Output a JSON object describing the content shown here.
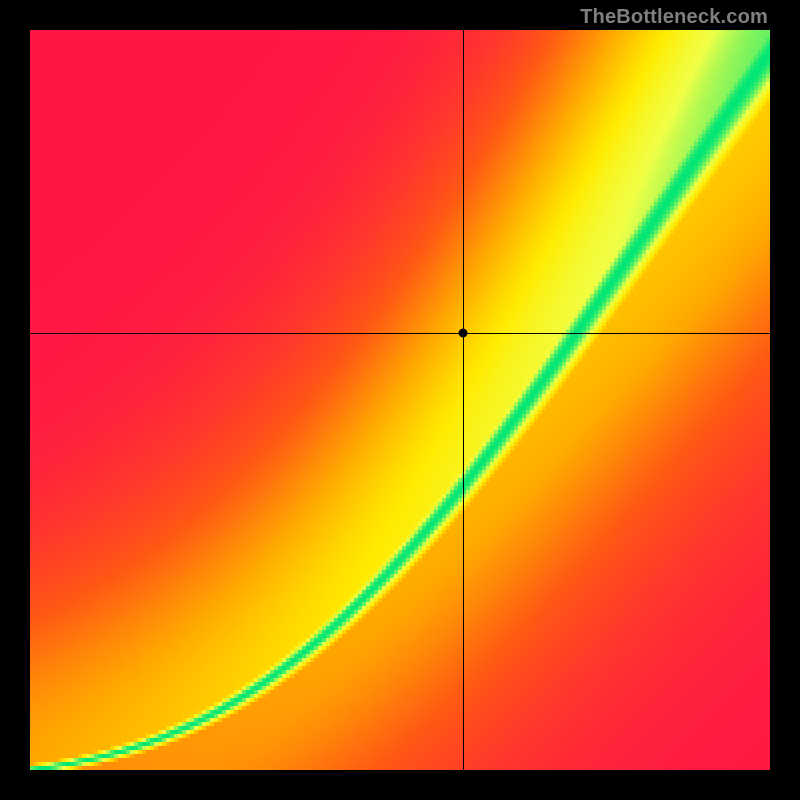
{
  "watermark": "TheBottleneck.com",
  "chart_data": {
    "type": "heatmap",
    "title": "",
    "xlabel": "",
    "ylabel": "",
    "xlim": [
      0,
      1
    ],
    "ylim": [
      0,
      1
    ],
    "crosshair": {
      "x": 0.585,
      "y": 0.59
    },
    "marker": {
      "x": 0.585,
      "y": 0.59
    },
    "curve_description": "green band follows a superlinear curve from bottom-left to top-right; optimal performance ridge",
    "colorscale": [
      "#ff1744",
      "#ff6d00",
      "#ffd600",
      "#ffff00",
      "#00e676"
    ],
    "resolution": 185
  }
}
